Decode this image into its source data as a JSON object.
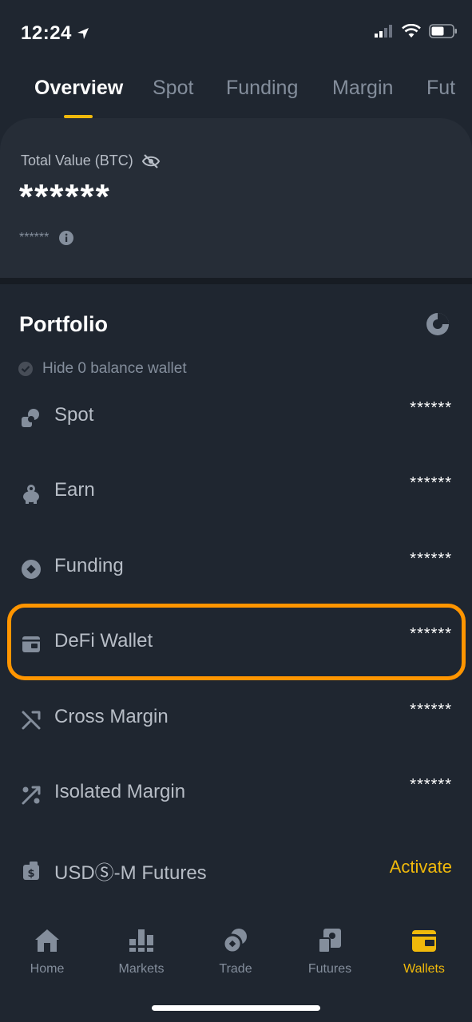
{
  "status_bar": {
    "time": "12:24"
  },
  "tabs": [
    {
      "label": "Overview",
      "active": true
    },
    {
      "label": "Spot"
    },
    {
      "label": "Funding"
    },
    {
      "label": "Margin"
    },
    {
      "label": "Fut"
    }
  ],
  "total_value": {
    "label": "Total Value (BTC)",
    "value": "******",
    "sub_value": "******"
  },
  "portfolio": {
    "title": "Portfolio",
    "hide_zero_label": "Hide 0 balance wallet",
    "rows": [
      {
        "name": "Spot",
        "value": "******",
        "icon": "spot-icon"
      },
      {
        "name": "Earn",
        "value": "******",
        "icon": "piggy-bank-icon"
      },
      {
        "name": "Funding",
        "value": "******",
        "icon": "funding-icon"
      },
      {
        "name": "DeFi Wallet",
        "value": "******",
        "icon": "defi-wallet-icon"
      },
      {
        "name": "Cross Margin",
        "value": "******",
        "icon": "cross-margin-icon"
      },
      {
        "name": "Isolated Margin",
        "value": "******",
        "icon": "isolated-margin-icon"
      },
      {
        "name": "USDⓈ-M Futures",
        "value": "Activate",
        "icon": "usd-futures-icon"
      }
    ]
  },
  "bottom_nav": [
    {
      "label": "Home",
      "icon": "home-icon"
    },
    {
      "label": "Markets",
      "icon": "markets-icon"
    },
    {
      "label": "Trade",
      "icon": "trade-icon"
    },
    {
      "label": "Futures",
      "icon": "futures-icon"
    },
    {
      "label": "Wallets",
      "icon": "wallet-icon",
      "active": true
    }
  ],
  "colors": {
    "background": "#1f2630",
    "card": "#262d37",
    "accent": "#f0b90b",
    "highlight": "#ff9500",
    "muted_text": "#848e9c"
  }
}
